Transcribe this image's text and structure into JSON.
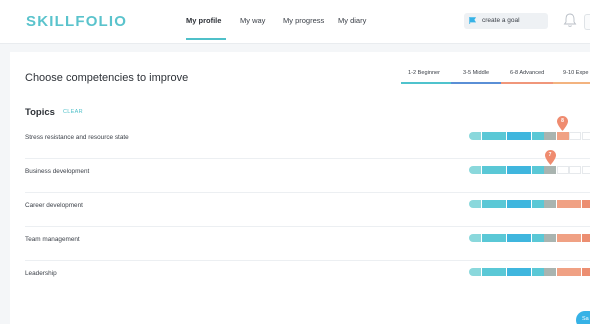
{
  "header": {
    "logo": "SKILLFOLIO",
    "nav": [
      "My profile",
      "My way",
      "My progress",
      "My diary"
    ],
    "goal_label": "create a goal"
  },
  "page": {
    "title": "Choose competencies to improve"
  },
  "levels": [
    {
      "label": "1-2 Beginner",
      "color": "#4fc3cd"
    },
    {
      "label": "3-5 Middle",
      "color": "#5a8fd6"
    },
    {
      "label": "6-8 Advanced",
      "color": "#f0967a"
    },
    {
      "label": "9-10 Expe",
      "color": "#f3b37f"
    }
  ],
  "topics": {
    "heading": "Topics",
    "clear_label": "CLEAR",
    "rows": [
      {
        "name": "Stress resistance and resource state",
        "score": 8,
        "filled": 8
      },
      {
        "name": "Business development",
        "score": 7,
        "filled": 7
      },
      {
        "name": "Career development",
        "score": null,
        "filled": 10
      },
      {
        "name": "Team management",
        "score": null,
        "filled": 10
      },
      {
        "name": "Leadership",
        "score": null,
        "filled": 10
      }
    ]
  },
  "colors": {
    "teal_1": "#8ad8dc",
    "teal_2": "#5ac8d6",
    "blue": "#3fb6de",
    "grey": "#a9b4b0",
    "salmon": "#f0a184",
    "salmon_dark": "#ec8e71",
    "pin": "#ef8b6f",
    "accent": "#4fc0c9"
  },
  "save_label": "Sa"
}
